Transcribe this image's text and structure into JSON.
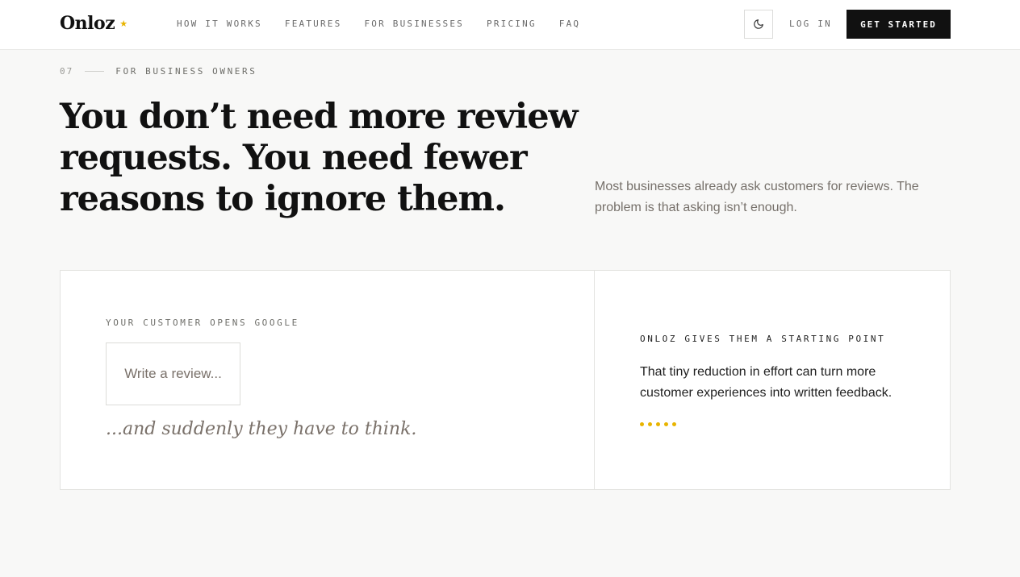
{
  "header": {
    "logo": "Onloz",
    "logo_star": "★",
    "nav": [
      "HOW IT WORKS",
      "FEATURES",
      "FOR BUSINESSES",
      "PRICING",
      "FAQ"
    ],
    "login": "LOG IN",
    "cta": "GET STARTED",
    "theme_icon": "moon-icon"
  },
  "section": {
    "number": "07",
    "eyebrow": "FOR BUSINESS OWNERS",
    "headline": "You don’t need more review requests. You need fewer reasons to ignore them.",
    "lede": "Most businesses already ask customers for reviews. The problem is that asking isn’t enough."
  },
  "cards": {
    "left": {
      "label": "YOUR CUSTOMER OPENS GOOGLE",
      "placeholder": "Write a review...",
      "caption": "...and suddenly they have to think."
    },
    "right": {
      "label": "ONLOZ GIVES THEM A STARTING POINT",
      "body": "That tiny reduction in effort can turn more customer experiences into written feedback."
    }
  },
  "colors": {
    "accent": "#e8b400",
    "ink": "#111111",
    "muted": "#76706a",
    "background": "#f8f8f7"
  }
}
